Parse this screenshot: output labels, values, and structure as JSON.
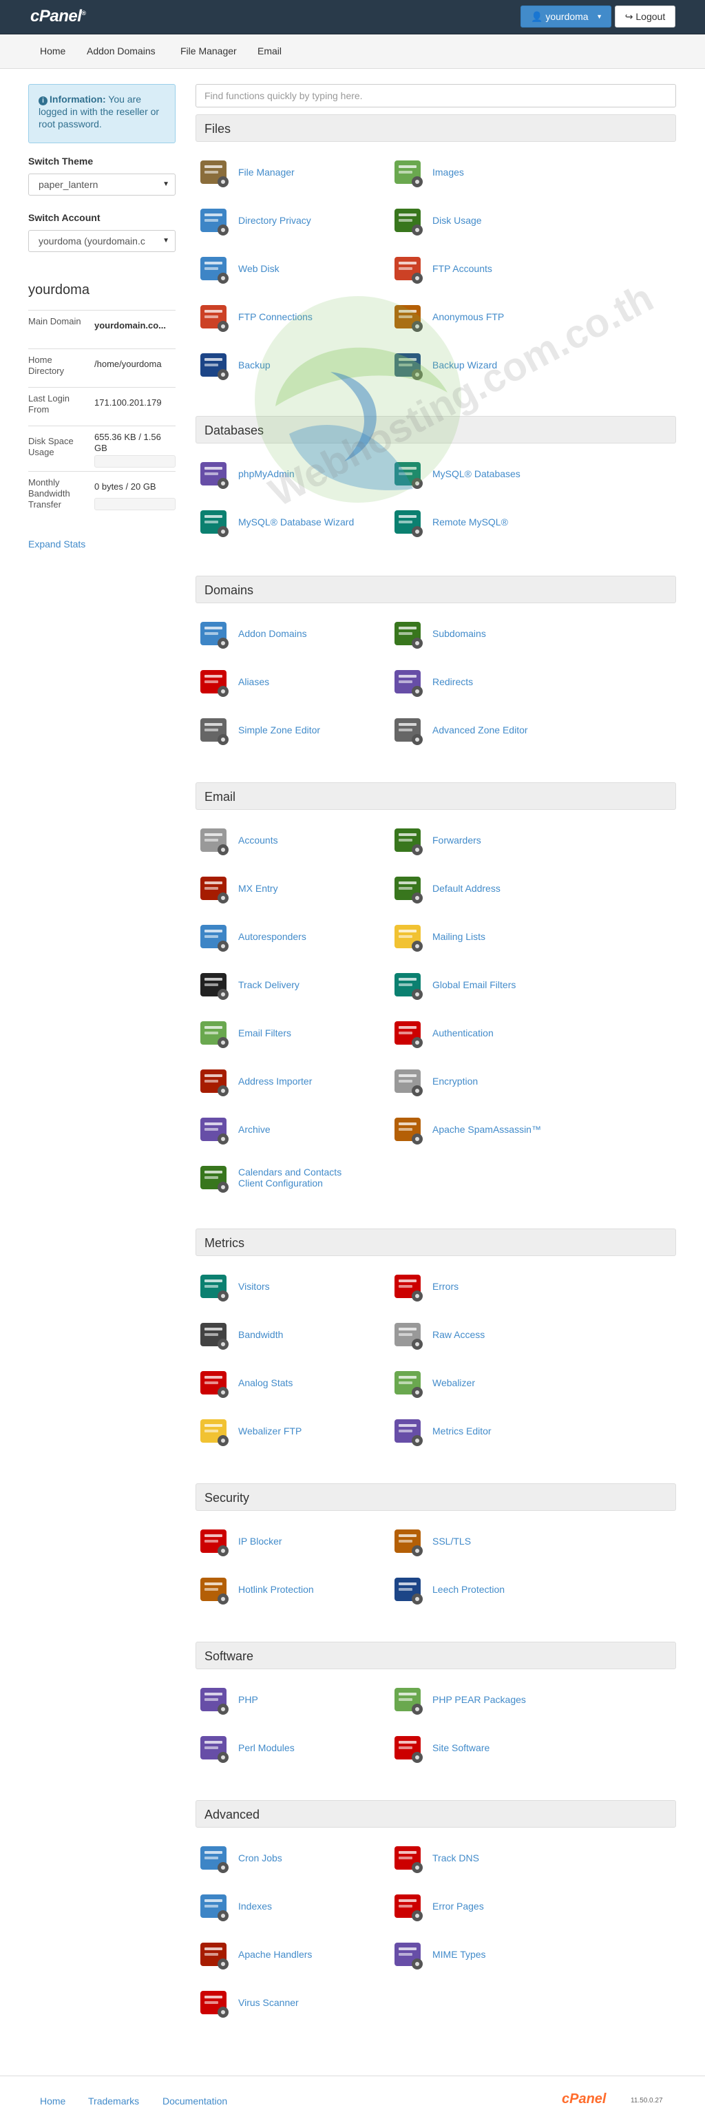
{
  "header": {
    "logo": "cPanel",
    "logo_mark": "®",
    "user_label": "yourdoma",
    "logout_label": "Logout"
  },
  "nav": [
    "Home",
    "Addon Domains",
    "File Manager",
    "Email"
  ],
  "sidebar": {
    "info_title": "Information:",
    "info_text": "You are logged in with the reseller or root password.",
    "switch_theme_label": "Switch Theme",
    "switch_theme_value": "paper_lantern",
    "switch_account_label": "Switch Account",
    "switch_account_value": "yourdoma (yourdomain.c",
    "username": "yourdoma",
    "stats": [
      {
        "key": "Main Domain",
        "value": "yourdomain.co..."
      },
      {
        "key": "Home Directory",
        "value": "/home/yourdoma"
      },
      {
        "key": "Last Login From",
        "value": "171.100.201.179"
      },
      {
        "key": "Disk Space Usage",
        "value": "655.36 KB / 1.56 GB",
        "fill": 0.0004
      },
      {
        "key": "Monthly Bandwidth Transfer",
        "value": "0 bytes / 20 GB",
        "fill": 0
      }
    ],
    "expand_label": "Expand Stats"
  },
  "search": {
    "placeholder": "Find functions quickly by typing here."
  },
  "groups": [
    {
      "title": "Files",
      "items": [
        {
          "label": "File Manager",
          "icon": "file-manager-icon",
          "color": "#8a6d3b"
        },
        {
          "label": "Images",
          "icon": "images-icon",
          "color": "#6aa84f"
        },
        {
          "label": "Directory Privacy",
          "icon": "directory-privacy-icon",
          "color": "#3d85c6"
        },
        {
          "label": "Disk Usage",
          "icon": "disk-usage-icon",
          "color": "#38761d"
        },
        {
          "label": "Web Disk",
          "icon": "web-disk-icon",
          "color": "#3d85c6"
        },
        {
          "label": "FTP Accounts",
          "icon": "ftp-accounts-icon",
          "color": "#cc4125"
        },
        {
          "label": "FTP Connections",
          "icon": "ftp-connections-icon",
          "color": "#cc4125"
        },
        {
          "label": "Anonymous FTP",
          "icon": "anonymous-ftp-icon",
          "color": "#b45f06"
        },
        {
          "label": "Backup",
          "icon": "backup-icon",
          "color": "#1c4587"
        },
        {
          "label": "Backup Wizard",
          "icon": "backup-wizard-icon",
          "color": "#1c4587"
        }
      ]
    },
    {
      "title": "Databases",
      "items": [
        {
          "label": "phpMyAdmin",
          "icon": "phpmyadmin-icon",
          "color": "#674ea7"
        },
        {
          "label": "MySQL® Databases",
          "icon": "mysql-databases-icon",
          "color": "#0b8070"
        },
        {
          "label": "MySQL® Database Wizard",
          "icon": "mysql-database-wizard-icon",
          "color": "#0b8070"
        },
        {
          "label": "Remote MySQL®",
          "icon": "remote-mysql-icon",
          "color": "#0b8070"
        }
      ]
    },
    {
      "title": "Domains",
      "items": [
        {
          "label": "Addon Domains",
          "icon": "addon-domains-icon",
          "color": "#3d85c6"
        },
        {
          "label": "Subdomains",
          "icon": "subdomains-icon",
          "color": "#38761d"
        },
        {
          "label": "Aliases",
          "icon": "aliases-icon",
          "color": "#cc0000"
        },
        {
          "label": "Redirects",
          "icon": "redirects-icon",
          "color": "#674ea7"
        },
        {
          "label": "Simple Zone Editor",
          "icon": "simple-zone-editor-icon",
          "color": "#666666"
        },
        {
          "label": "Advanced Zone Editor",
          "icon": "advanced-zone-editor-icon",
          "color": "#666666"
        }
      ]
    },
    {
      "title": "Email",
      "items": [
        {
          "label": "Accounts",
          "icon": "email-accounts-icon",
          "color": "#999999"
        },
        {
          "label": "Forwarders",
          "icon": "forwarders-icon",
          "color": "#38761d"
        },
        {
          "label": "MX Entry",
          "icon": "mx-entry-icon",
          "color": "#a61c00"
        },
        {
          "label": "Default Address",
          "icon": "default-address-icon",
          "color": "#38761d"
        },
        {
          "label": "Autoresponders",
          "icon": "autoresponders-icon",
          "color": "#3d85c6"
        },
        {
          "label": "Mailing Lists",
          "icon": "mailing-lists-icon",
          "color": "#f1c232"
        },
        {
          "label": "Track Delivery",
          "icon": "track-delivery-icon",
          "color": "#222222"
        },
        {
          "label": "Global Email Filters",
          "icon": "global-email-filters-icon",
          "color": "#0b8070"
        },
        {
          "label": "Email Filters",
          "icon": "email-filters-icon",
          "color": "#6aa84f"
        },
        {
          "label": "Authentication",
          "icon": "authentication-icon",
          "color": "#cc0000"
        },
        {
          "label": "Address Importer",
          "icon": "address-importer-icon",
          "color": "#a61c00"
        },
        {
          "label": "Encryption",
          "icon": "encryption-icon",
          "color": "#999999"
        },
        {
          "label": "Archive",
          "icon": "archive-icon",
          "color": "#674ea7"
        },
        {
          "label": "Apache SpamAssassin™",
          "icon": "spamassassin-icon",
          "color": "#b45f06"
        },
        {
          "label": "Calendars and Contacts",
          "label2": "Client Configuration",
          "icon": "calendars-contacts-icon",
          "color": "#38761d"
        }
      ]
    },
    {
      "title": "Metrics",
      "items": [
        {
          "label": "Visitors",
          "icon": "visitors-icon",
          "color": "#0b8070"
        },
        {
          "label": "Errors",
          "icon": "errors-icon",
          "color": "#cc0000"
        },
        {
          "label": "Bandwidth",
          "icon": "bandwidth-icon",
          "color": "#434343"
        },
        {
          "label": "Raw Access",
          "icon": "raw-access-icon",
          "color": "#999999"
        },
        {
          "label": "Analog Stats",
          "icon": "analog-stats-icon",
          "color": "#cc0000"
        },
        {
          "label": "Webalizer",
          "icon": "webalizer-icon",
          "color": "#6aa84f"
        },
        {
          "label": "Webalizer FTP",
          "icon": "webalizer-ftp-icon",
          "color": "#f1c232"
        },
        {
          "label": "Metrics Editor",
          "icon": "metrics-editor-icon",
          "color": "#674ea7"
        }
      ]
    },
    {
      "title": "Security",
      "items": [
        {
          "label": "IP Blocker",
          "icon": "ip-blocker-icon",
          "color": "#cc0000"
        },
        {
          "label": "SSL/TLS",
          "icon": "ssl-tls-icon",
          "color": "#b45f06"
        },
        {
          "label": "Hotlink Protection",
          "icon": "hotlink-protection-icon",
          "color": "#b45f06"
        },
        {
          "label": "Leech Protection",
          "icon": "leech-protection-icon",
          "color": "#1c4587"
        }
      ]
    },
    {
      "title": "Software",
      "items": [
        {
          "label": "PHP",
          "icon": "php-icon",
          "color": "#674ea7"
        },
        {
          "label": "PHP PEAR Packages",
          "icon": "php-pear-icon",
          "color": "#6aa84f"
        },
        {
          "label": "Perl Modules",
          "icon": "perl-modules-icon",
          "color": "#674ea7"
        },
        {
          "label": "Site Software",
          "icon": "site-software-icon",
          "color": "#cc0000"
        }
      ]
    },
    {
      "title": "Advanced",
      "items": [
        {
          "label": "Cron Jobs",
          "icon": "cron-jobs-icon",
          "color": "#3d85c6"
        },
        {
          "label": "Track DNS",
          "icon": "track-dns-icon",
          "color": "#cc0000"
        },
        {
          "label": "Indexes",
          "icon": "indexes-icon",
          "color": "#3d85c6"
        },
        {
          "label": "Error Pages",
          "icon": "error-pages-icon",
          "color": "#cc0000"
        },
        {
          "label": "Apache Handlers",
          "icon": "apache-handlers-icon",
          "color": "#a61c00"
        },
        {
          "label": "MIME Types",
          "icon": "mime-types-icon",
          "color": "#674ea7"
        },
        {
          "label": "Virus Scanner",
          "icon": "virus-scanner-icon",
          "color": "#cc0000"
        }
      ]
    }
  ],
  "watermark": "Webhosting.com.co.th",
  "footer": {
    "links": [
      "Home",
      "Trademarks",
      "Documentation"
    ],
    "logo": "cPanel",
    "version": "11.50.0.27"
  }
}
